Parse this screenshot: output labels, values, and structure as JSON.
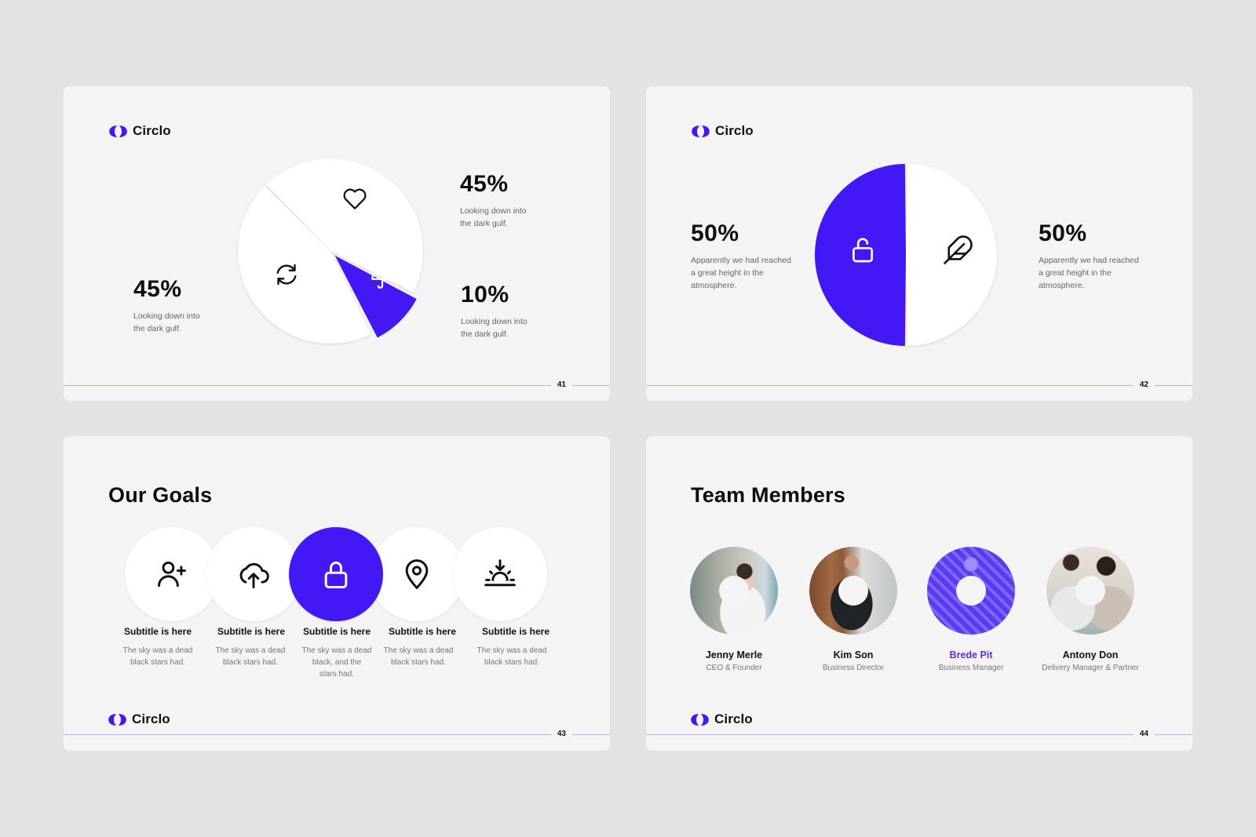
{
  "brand": {
    "name": "Circlo",
    "accent_color": "#4318f5",
    "icon": "circlo-logo-icon"
  },
  "slides": {
    "s41": {
      "page_number": "41",
      "chart_data": {
        "type": "pie",
        "title": "",
        "slices": [
          {
            "label": "Heart segment",
            "value": 45,
            "icon": "heart-icon",
            "highlight": false
          },
          {
            "label": "Umbrella segment",
            "value": 10,
            "icon": "umbrella-icon",
            "highlight": true
          },
          {
            "label": "Refresh segment",
            "value": 45,
            "icon": "refresh-icon",
            "highlight": false
          }
        ]
      },
      "stats": [
        {
          "value": "45%",
          "text_line1": "Looking down into",
          "text_line2": "the dark gulf."
        },
        {
          "value": "10%",
          "text_line1": "Looking down into",
          "text_line2": "the dark gulf."
        },
        {
          "value": "45%",
          "text_line1": "Looking down into",
          "text_line2": "the dark gulf."
        }
      ]
    },
    "s42": {
      "page_number": "42",
      "chart_data": {
        "type": "pie",
        "title": "",
        "slices": [
          {
            "label": "Unlock segment",
            "value": 50,
            "icon": "unlock-icon",
            "highlight": true
          },
          {
            "label": "Feather segment",
            "value": 50,
            "icon": "feather-icon",
            "highlight": false
          }
        ]
      },
      "stats": [
        {
          "value": "50%",
          "text_line1": "Apparently  we had reached",
          "text_line2": "a great height in the",
          "text_line3": "atmosphere."
        },
        {
          "value": "50%",
          "text_line1": "Apparently  we had reached",
          "text_line2": "a great height in the",
          "text_line3": "atmosphere."
        }
      ]
    },
    "s43": {
      "page_number": "43",
      "title": "Our Goals",
      "goals": [
        {
          "icon": "user-plus-icon",
          "subtitle": "Subtitle is here",
          "line1": "The sky was a dead",
          "line2": "black stars had.",
          "line3": "",
          "active": false
        },
        {
          "icon": "cloud-upload-icon",
          "subtitle": "Subtitle is here",
          "line1": "The sky was a dead",
          "line2": "black stars had.",
          "line3": "",
          "active": false
        },
        {
          "icon": "lock-icon",
          "subtitle": "Subtitle is here",
          "line1": "The sky was a dead",
          "line2": "black, and the",
          "line3": "stars had.",
          "active": true
        },
        {
          "icon": "map-pin-icon",
          "subtitle": "Subtitle is here",
          "line1": "The sky was a dead",
          "line2": "black stars had.",
          "line3": "",
          "active": false
        },
        {
          "icon": "sunset-icon",
          "subtitle": "Subtitle is here",
          "line1": "The sky was a dead",
          "line2": "black stars had.",
          "line3": "",
          "active": false
        }
      ]
    },
    "s44": {
      "page_number": "44",
      "title": "Team Members",
      "members": [
        {
          "name": "Jenny Merle",
          "role": "CEO & Founder",
          "highlight": false
        },
        {
          "name": "Kim Son",
          "role": "Business Director",
          "highlight": false
        },
        {
          "name": "Brede Pit",
          "role": "Business Manager",
          "highlight": true
        },
        {
          "name": "Antony Don",
          "role": "Delivery Manager & Partner",
          "highlight": false
        }
      ]
    }
  }
}
